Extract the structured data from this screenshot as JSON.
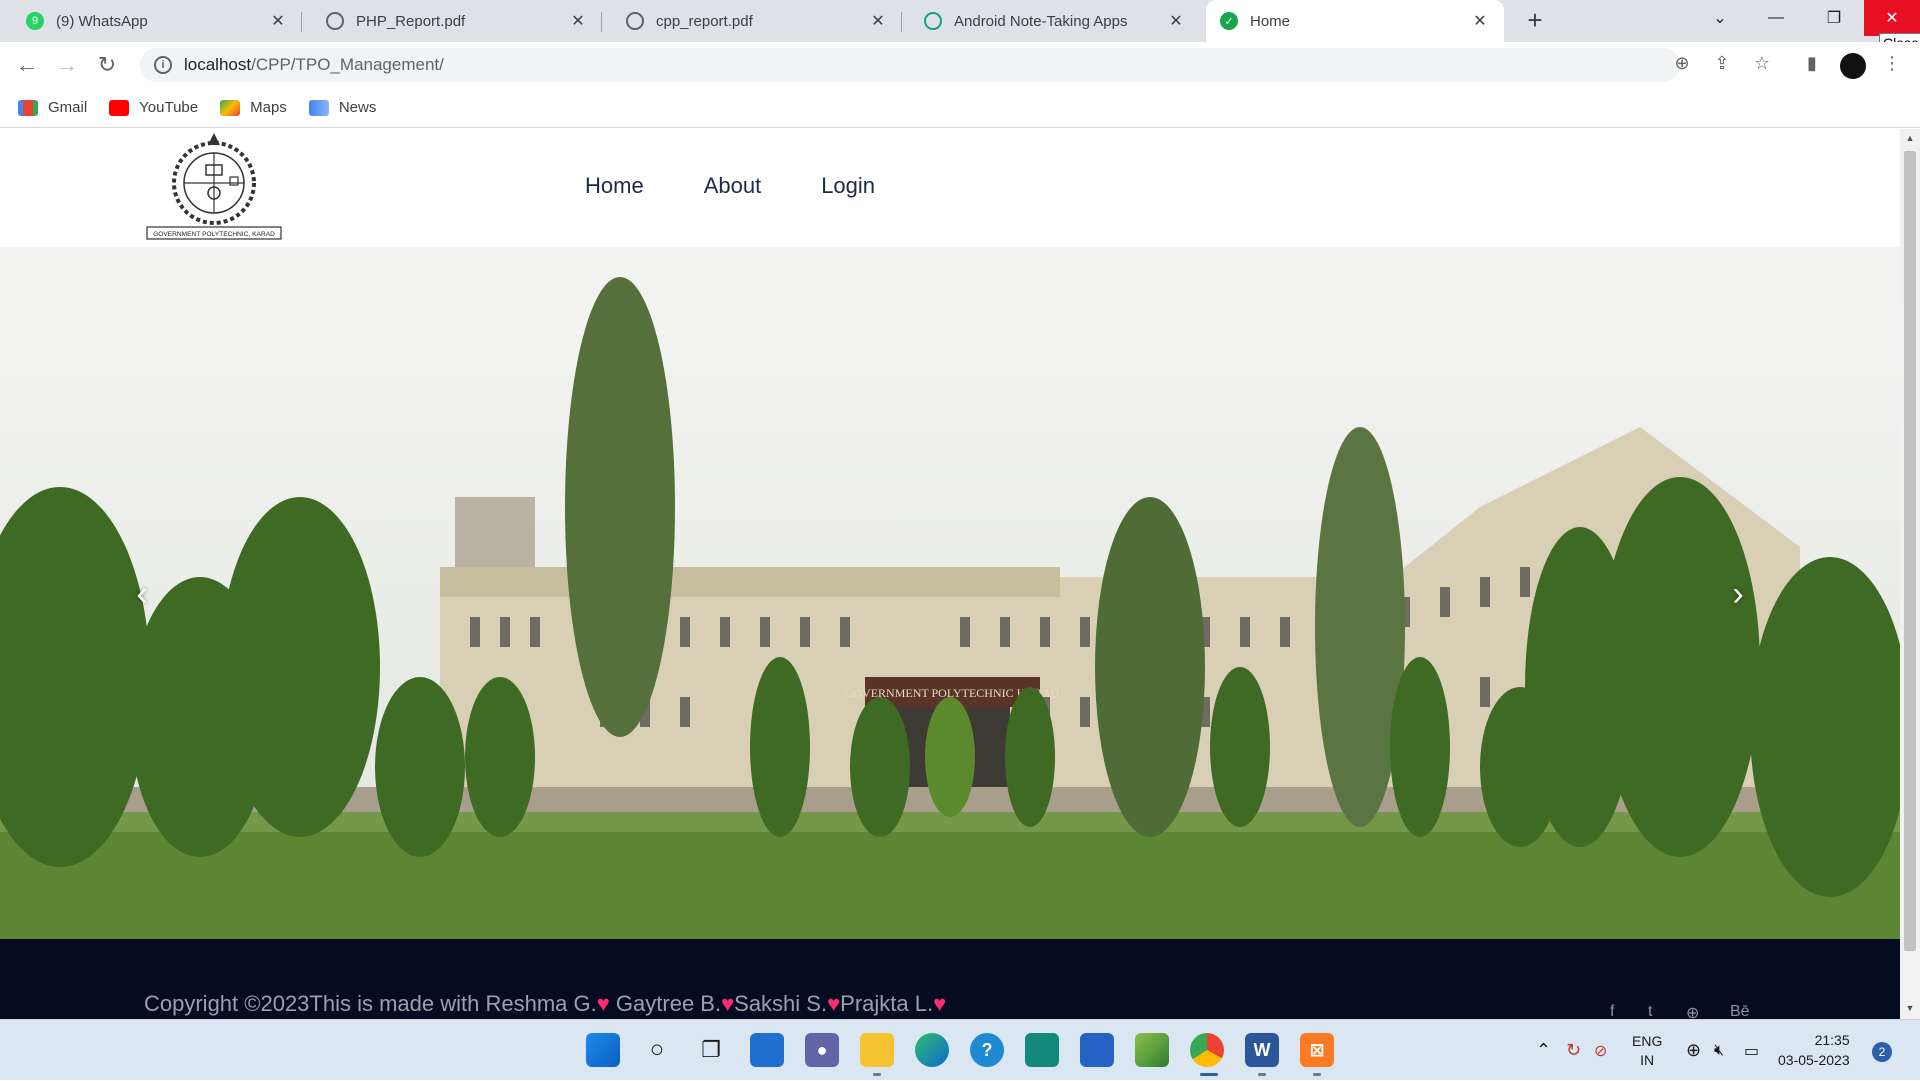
{
  "browser": {
    "tabs": [
      {
        "title": "(9) WhatsApp",
        "icon": "whatsapp-icon",
        "active": false
      },
      {
        "title": "PHP_Report.pdf",
        "icon": "globe-icon",
        "active": false
      },
      {
        "title": "cpp_report.pdf",
        "icon": "globe-icon",
        "active": false
      },
      {
        "title": "Android Note-Taking Apps",
        "icon": "chatgpt-icon",
        "active": false
      },
      {
        "title": "Home",
        "icon": "check-circle-icon",
        "active": true
      }
    ],
    "close_tooltip": "Close",
    "url_host": "localhost",
    "url_path": "/CPP/TPO_Management/",
    "bookmarks": [
      "Gmail",
      "YouTube",
      "Maps",
      "News"
    ]
  },
  "site": {
    "logo_caption": "GOVERNMENT POLYTECHNIC, KARAD",
    "nav": [
      "Home",
      "About",
      "Login"
    ],
    "hero_sign": "GOVERNMENT POLYTECHNIC KARAD",
    "footer": {
      "copyright_prefix": "Copyright ©2023This is made with Reshma G.",
      "names": [
        "Gaytree B.",
        "Sakshi S.",
        "Prajkta L."
      ],
      "heart": "♥",
      "social": [
        "f",
        "t",
        "⊕",
        "Bē"
      ]
    }
  },
  "taskbar": {
    "lang_top": "ENG",
    "lang_bottom": "IN",
    "time": "21:35",
    "date": "03-05-2023",
    "notifications": "2"
  },
  "colors": {
    "footer_bg": "#050c22",
    "heart": "#ff2d6f",
    "nav_text": "#1e2a4a",
    "close_button": "#e81123"
  }
}
